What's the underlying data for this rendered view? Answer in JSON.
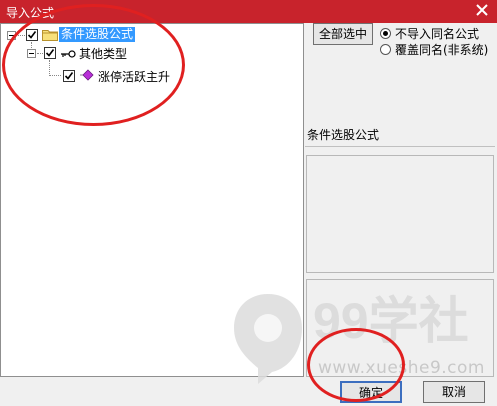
{
  "window": {
    "title": "导入公式"
  },
  "tree": {
    "root": {
      "label": "条件选股公式",
      "checked": true
    },
    "child": {
      "label": "其他类型",
      "checked": true
    },
    "leaf": {
      "label": "涨停活跃主升",
      "checked": true
    }
  },
  "right": {
    "select_all_label": "全部选中",
    "radio_options": [
      {
        "label": "不导入同名公式",
        "selected": true
      },
      {
        "label": "覆盖同名(非系统)",
        "selected": false
      }
    ],
    "category_label": "条件选股公式"
  },
  "footer": {
    "ok_label": "确定",
    "cancel_label": "取消"
  },
  "watermark": {
    "url": "www.xueshe9.com"
  },
  "colors": {
    "titlebar": "#c8232c",
    "selection": "#3399ff",
    "annotation": "#e02020"
  }
}
